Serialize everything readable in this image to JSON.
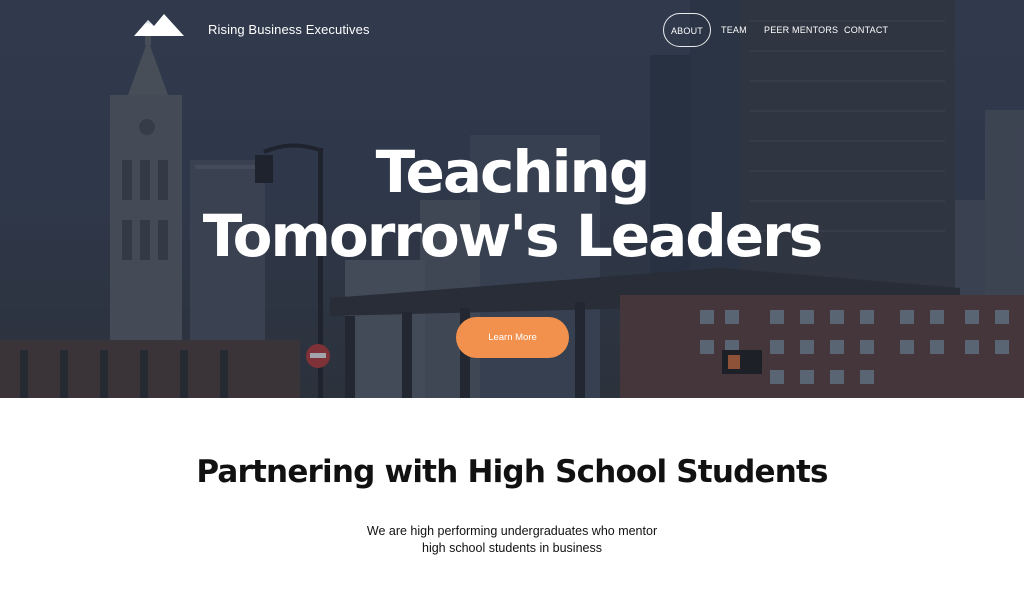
{
  "header": {
    "brand": "Rising Business Executives",
    "logo_icon": "mountain-icon",
    "nav": [
      {
        "label": "About",
        "active": true
      },
      {
        "label": "Team",
        "active": false
      },
      {
        "label": "Peer Mentors",
        "active": false
      },
      {
        "label": "Contact",
        "active": false
      }
    ]
  },
  "hero": {
    "title_line1": "Teaching",
    "title_line2": "Tomorrow's Leaders",
    "cta_label": "Learn More",
    "background_image": "city-skyline-photo"
  },
  "section": {
    "title": "Partnering with High School Students",
    "body_line1": "We are high performing undergraduates who mentor",
    "body_line2": "high school students in business"
  },
  "colors": {
    "accent": "#f2914d",
    "hero_overlay": "#3a4356",
    "text_dark": "#111111",
    "text_light": "#ffffff"
  }
}
